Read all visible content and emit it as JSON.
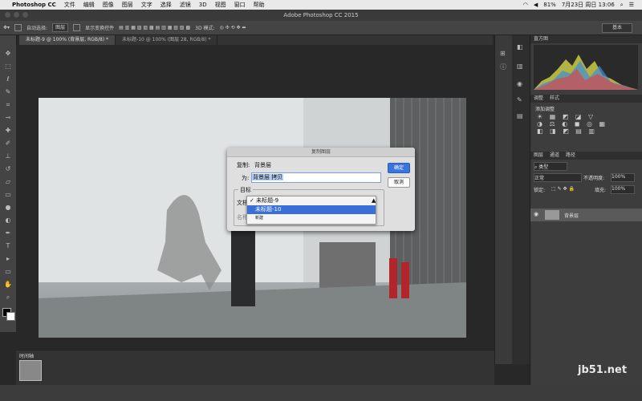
{
  "menubar": {
    "app": "Photoshop CC",
    "items": [
      "文件",
      "编辑",
      "图像",
      "图层",
      "文字",
      "选择",
      "滤镜",
      "3D",
      "视图",
      "窗口",
      "帮助"
    ],
    "battery": "81%",
    "datetime": "7月23日 周日 13:06"
  },
  "window": {
    "title": "Adobe Photoshop CC 2015"
  },
  "options": {
    "auto_select_label": "自动选择:",
    "auto_select_value": "图层",
    "show_transform_label": "显示变换控件",
    "mode3d_label": "3D 模式:",
    "workspace": "基本"
  },
  "tabs": [
    {
      "label": "未标题-9 @ 100% (背景层, RGB/8) *"
    },
    {
      "label": "未标题-10 @ 100% (图层 28, RGB/8) *"
    }
  ],
  "dialog": {
    "title": "复制图层",
    "copy_label": "复制:",
    "copy_value": "背景层",
    "as_label": "为:",
    "as_value": "背景层 拷贝",
    "dest_group": "目标",
    "doc_label": "文档:",
    "name_label": "名称:",
    "options": [
      "未标题-9",
      "未标题-10",
      "新建"
    ],
    "ok": "确定",
    "cancel": "取消"
  },
  "panels": {
    "histogram_tab": "直方图",
    "adjust_tabs": [
      "调整",
      "样式"
    ],
    "adjust_title": "添加调整",
    "layers_tabs": [
      "图层",
      "通道",
      "路径"
    ],
    "kind_label": "类型",
    "blend_mode": "正常",
    "opacity_label": "不透明度:",
    "opacity": "100%",
    "lock_label": "锁定:",
    "fill_label": "填充:",
    "fill": "100%",
    "layer_name": "背景层"
  },
  "filmstrip": {
    "label": "时间轴"
  },
  "watermark": "jb51.net",
  "colors": {
    "accent": "#3b6fd8",
    "dialog_bg": "#dfdfdf"
  }
}
